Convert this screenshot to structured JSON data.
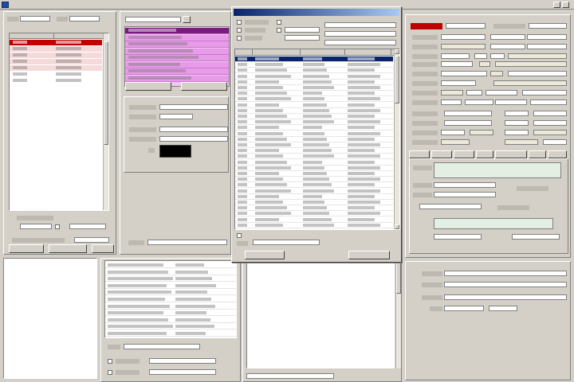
{
  "window": {
    "title": ""
  },
  "left_list": {
    "rows": [
      {
        "id": "",
        "date": "",
        "state": "selected-red"
      },
      {
        "id": "",
        "date": "",
        "state": "pink"
      },
      {
        "id": "",
        "date": "",
        "state": "pink"
      },
      {
        "id": "",
        "date": "",
        "state": "pink"
      },
      {
        "id": "",
        "date": "",
        "state": "pink"
      },
      {
        "id": "",
        "date": "",
        "state": "normal"
      },
      {
        "id": "",
        "date": "",
        "state": "normal"
      }
    ],
    "buttons": [
      "",
      "",
      ""
    ]
  },
  "magenta_list": {
    "item_count": 8
  },
  "color_swatch": "#000000",
  "grid_popup": {
    "title": "",
    "columns": [
      "",
      "",
      "",
      ""
    ],
    "row_count": 30,
    "ok_label": "",
    "cancel_label": ""
  },
  "colors": {
    "selection_red": "#c00000",
    "pink_row": "#f6dada",
    "magenta_selected": "#7a1c7e",
    "magenta_row": "#e79be9",
    "navy_header": "#0a246a",
    "dialog_bg": "#d4d0c8",
    "green_field": "#e3efe2"
  },
  "icons": [
    "app-icon",
    "minimize-icon",
    "close-icon",
    "checkbox-icon",
    "dropdown-icon",
    "scroll-up-icon",
    "scroll-down-icon"
  ]
}
